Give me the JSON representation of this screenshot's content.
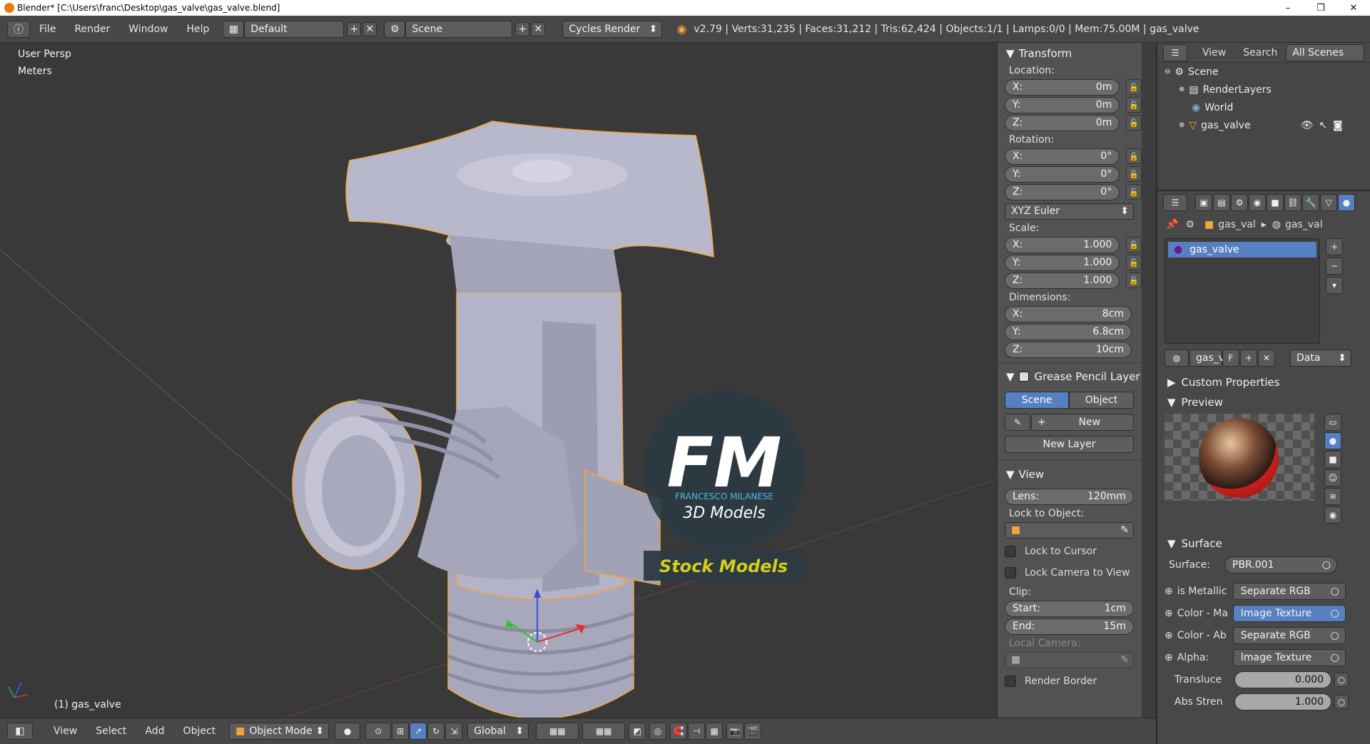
{
  "window": {
    "title": "Blender* [C:\\Users\\franc\\Desktop\\gas_valve\\gas_valve.blend]",
    "minimize": "–",
    "maximize": "❐",
    "close": "✕"
  },
  "info_header": {
    "menus": [
      "File",
      "Render",
      "Window",
      "Help"
    ],
    "screen_layout": "Default",
    "scene": "Scene",
    "render_engine": "Cycles Render",
    "stats": "v2.79 | Verts:31,235 | Faces:31,212 | Tris:62,424 | Objects:1/1 | Lamps:0/0 | Mem:75.00M | gas_valve"
  },
  "viewport": {
    "view_name": "User Persp",
    "units": "Meters",
    "active_object": "(1) gas_valve",
    "watermark": {
      "logo_letters": "FM",
      "brand": "FRANCESCO MILANESE",
      "subtitle": "3D Models",
      "banner": "Stock Models"
    }
  },
  "transform_panel": {
    "title": "Transform",
    "location_label": "Location:",
    "location": [
      {
        "axis": "X:",
        "value": "0m"
      },
      {
        "axis": "Y:",
        "value": "0m"
      },
      {
        "axis": "Z:",
        "value": "0m"
      }
    ],
    "rotation_label": "Rotation:",
    "rotation": [
      {
        "axis": "X:",
        "value": "0°"
      },
      {
        "axis": "Y:",
        "value": "0°"
      },
      {
        "axis": "Z:",
        "value": "0°"
      }
    ],
    "rotation_mode": "XYZ Euler",
    "scale_label": "Scale:",
    "scale": [
      {
        "axis": "X:",
        "value": "1.000"
      },
      {
        "axis": "Y:",
        "value": "1.000"
      },
      {
        "axis": "Z:",
        "value": "1.000"
      }
    ],
    "dimensions_label": "Dimensions:",
    "dimensions": [
      {
        "axis": "X:",
        "value": "8cm"
      },
      {
        "axis": "Y:",
        "value": "6.8cm"
      },
      {
        "axis": "Z:",
        "value": "10cm"
      }
    ]
  },
  "grease_pencil_panel": {
    "title": "Grease Pencil Layer",
    "tabs": [
      "Scene",
      "Object"
    ],
    "active_tab": "Scene",
    "new_label": "New",
    "new_layer_label": "New Layer"
  },
  "view_panel": {
    "title": "View",
    "lens_label": "Lens:",
    "lens_value": "120mm",
    "lock_to_object": "Lock to Object:",
    "lock_to_cursor": "Lock to Cursor",
    "lock_camera": "Lock Camera to View",
    "clip_label": "Clip:",
    "clip_start_label": "Start:",
    "clip_start": "1cm",
    "clip_end_label": "End:",
    "clip_end": "15m",
    "local_camera": "Local Camera:",
    "render_border": "Render Border"
  },
  "outliner": {
    "view_menu": "View",
    "search_menu": "Search",
    "display_mode": "All Scenes",
    "items": [
      {
        "label": "Scene",
        "indent": 0
      },
      {
        "label": "RenderLayers",
        "indent": 1
      },
      {
        "label": "World",
        "indent": 1
      },
      {
        "label": "gas_valve",
        "indent": 1
      }
    ]
  },
  "properties": {
    "breadcrumb": [
      "gas_val",
      "gas_val"
    ],
    "material_slot": "gas_valve",
    "material_name": "gas_v",
    "fake_user": "F",
    "link_mode": "Data",
    "custom_properties": "Custom Properties",
    "preview": "Preview",
    "surface_section": "Surface",
    "surface_label": "Surface:",
    "surface_value": "PBR.001",
    "inputs": [
      {
        "label": "is Metallic",
        "value": "Separate RGB",
        "highlight": false
      },
      {
        "label": "Color - Ma",
        "value": "Image Texture",
        "highlight": true
      },
      {
        "label": "Color - Ab",
        "value": "Separate RGB",
        "highlight": false
      },
      {
        "label": "Alpha:",
        "value": "Image Texture",
        "highlight": false
      }
    ],
    "translucency_label": "Transluce",
    "translucency": "0.000",
    "abs_strength_label": "Abs Stren",
    "abs_strength": "1.000"
  },
  "bottom_header": {
    "menus": [
      "View",
      "Select",
      "Add",
      "Object"
    ],
    "mode": "Object Mode",
    "orientation": "Global"
  },
  "colors": {
    "accent_blue": "#5680c2",
    "selection_orange": "#f4a43c",
    "watermark_yellow": "#d6cf1a",
    "watermark_cyan": "#4fb8e6",
    "material_red": "#c81e1e"
  }
}
